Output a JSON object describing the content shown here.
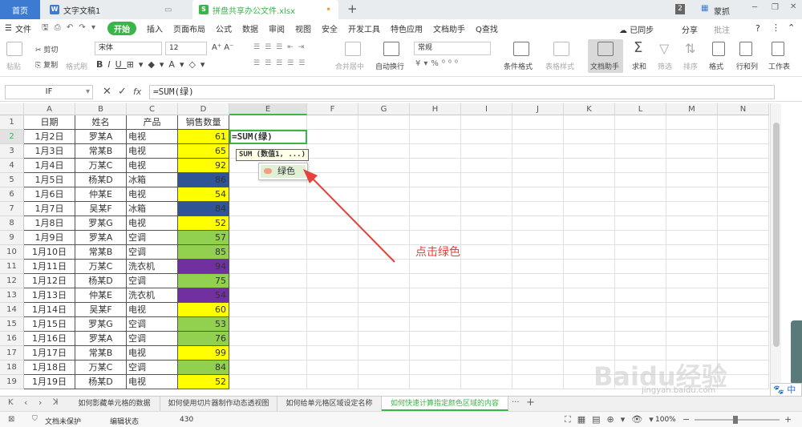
{
  "titlebar": {
    "home": "首页",
    "doc_tab": "文字文稿1",
    "xls_tab": "拼盘共享办公文件.xlsx",
    "add": "+",
    "badge": "2",
    "user": "蒙抓"
  },
  "menu": {
    "file": "文件",
    "start": "开始",
    "items": [
      "插入",
      "页面布局",
      "公式",
      "数据",
      "审阅",
      "视图",
      "安全",
      "开发工具",
      "特色应用",
      "文档助手"
    ],
    "search": "Q查找",
    "sync": "已同步",
    "share": "分享",
    "comment": "批注",
    "help": "?"
  },
  "ribbon": {
    "paste": "粘贴",
    "cut": "剪切",
    "copy": "复制",
    "format_painter": "格式刷",
    "font": "宋体",
    "size": "12",
    "merge": "合并居中",
    "wrap": "自动换行",
    "numfmt": "常规",
    "cond": "条件格式",
    "tablefmt": "表格样式",
    "docassist": "文档助手",
    "sum": "求和",
    "filter": "筛选",
    "sort": "排序",
    "fill": "填充",
    "format": "格式",
    "rowcol": "行和列",
    "sheet": "工作表"
  },
  "formula": {
    "namebox": "IF",
    "fx": "fx",
    "value": "=SUM(绿)"
  },
  "columns": [
    "A",
    "B",
    "C",
    "D",
    "E",
    "F",
    "G",
    "H",
    "I",
    "J",
    "K",
    "L",
    "M",
    "N"
  ],
  "header_row": {
    "date": "日期",
    "name": "姓名",
    "product": "产品",
    "sales": "销售数量"
  },
  "rows": [
    [
      "1月2日",
      "罗某A",
      "电视",
      "61"
    ],
    [
      "1月3日",
      "常某B",
      "电视",
      "65"
    ],
    [
      "1月4日",
      "万某C",
      "电视",
      "92"
    ],
    [
      "1月5日",
      "杨某D",
      "冰箱",
      "86"
    ],
    [
      "1月6日",
      "仲某E",
      "电视",
      "54"
    ],
    [
      "1月7日",
      "吴某F",
      "冰箱",
      "84"
    ],
    [
      "1月8日",
      "罗某G",
      "电视",
      "52"
    ],
    [
      "1月9日",
      "罗某A",
      "空调",
      "57"
    ],
    [
      "1月10日",
      "常某B",
      "空调",
      "85"
    ],
    [
      "1月11日",
      "万某C",
      "洗衣机",
      "94"
    ],
    [
      "1月12日",
      "杨某D",
      "空调",
      "75"
    ],
    [
      "1月13日",
      "仲某E",
      "洗衣机",
      "54"
    ],
    [
      "1月14日",
      "吴某F",
      "电视",
      "60"
    ],
    [
      "1月15日",
      "罗某G",
      "空调",
      "53"
    ],
    [
      "1月16日",
      "罗某A",
      "空调",
      "76"
    ],
    [
      "1月17日",
      "常某B",
      "电视",
      "99"
    ],
    [
      "1月18日",
      "万某C",
      "空调",
      "84"
    ],
    [
      "1月19日",
      "杨某D",
      "电视",
      "52"
    ]
  ],
  "row_numbers": [
    "1",
    "2",
    "3",
    "4",
    "5",
    "6",
    "7",
    "8",
    "9",
    "10",
    "11",
    "12",
    "13",
    "14",
    "15",
    "16",
    "17",
    "18",
    "19"
  ],
  "fill_colors": [
    "#ffff00",
    "#ffff00",
    "#ffff00",
    "#2f5597",
    "#ffff00",
    "#2f5597",
    "#ffff00",
    "#92d050",
    "#92d050",
    "#7030a0",
    "#92d050",
    "#7030a0",
    "#ffff00",
    "#92d050",
    "#92d050",
    "#ffff00",
    "#92d050",
    "#ffff00"
  ],
  "active_cell": "=SUM(绿)",
  "tooltip": "SUM (数值1, ...)",
  "autocomplete": "绿色",
  "annotation": "点击绿色",
  "sheets": [
    "如何影藏单元格的数据",
    "如何使用切片器制作动态透视图",
    "如何给单元格区域设定名称",
    "如何快速计算指定颜色区域的内容"
  ],
  "sheet_more": "···",
  "sheet_add": "+",
  "status": {
    "protect": "文档未保护",
    "mode": "编辑状态",
    "count": "430",
    "zoom": "100%"
  },
  "watermark": {
    "main": "Baidu经验",
    "sub": "jingyan.baidu.com"
  },
  "ime": "中"
}
